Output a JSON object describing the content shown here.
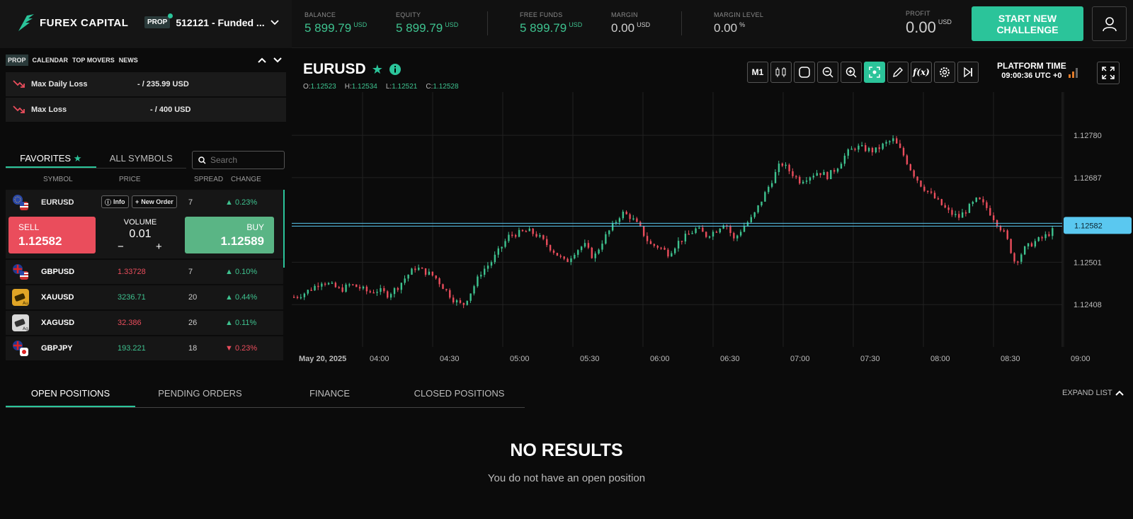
{
  "brand": {
    "name": "FUREX CAPITAL"
  },
  "account": {
    "badge": "PROP",
    "name": "512121 - Funded ..."
  },
  "stats": {
    "balance": {
      "label": "BALANCE",
      "value": "5 899.79",
      "unit": "USD"
    },
    "equity": {
      "label": "EQUITY",
      "value": "5 899.79",
      "unit": "USD"
    },
    "free_funds": {
      "label": "FREE FUNDS",
      "value": "5 899.79",
      "unit": "USD"
    },
    "margin": {
      "label": "MARGIN",
      "value": "0.00",
      "unit": "USD"
    },
    "margin_level": {
      "label": "MARGIN LEVEL",
      "value": "0.00",
      "unit": "%"
    },
    "profit": {
      "label": "PROFIT",
      "value": "0.00",
      "unit": "USD"
    }
  },
  "challenge_button": "START NEW CHALLENGE",
  "subnav": [
    "PROP",
    "CALENDAR",
    "TOP MOVERS",
    "NEWS"
  ],
  "risk": [
    {
      "label": "Max Daily Loss",
      "value": "- / 235.99 USD"
    },
    {
      "label": "Max Loss",
      "value": "- / 400 USD"
    }
  ],
  "symbol_tabs": {
    "favorites": "FAVORITES",
    "all": "ALL SYMBOLS"
  },
  "search": {
    "placeholder": "Search"
  },
  "columns": {
    "symbol": "SYMBOL",
    "price": "PRICE",
    "spread": "SPREAD",
    "change": "CHANGE"
  },
  "eurusd": {
    "name": "EURUSD",
    "spread": "7",
    "change": "0.23%",
    "info_label": "Info",
    "order_label": "New Order",
    "sell_label": "SELL",
    "sell_price": "1.12582",
    "buy_label": "BUY",
    "buy_price": "1.12589",
    "volume_label": "VOLUME",
    "volume": "0.01"
  },
  "symbols": [
    {
      "name": "GBPUSD",
      "price": "1.33728",
      "price_dir": "down",
      "spread": "7",
      "change": "0.10%",
      "change_dir": "up"
    },
    {
      "name": "XAUUSD",
      "price": "3236.71",
      "price_dir": "up",
      "spread": "20",
      "change": "0.44%",
      "change_dir": "up"
    },
    {
      "name": "XAGUSD",
      "price": "32.386",
      "price_dir": "down",
      "spread": "26",
      "change": "0.11%",
      "change_dir": "up"
    },
    {
      "name": "GBPJPY",
      "price": "193.221",
      "price_dir": "up",
      "spread": "18",
      "change": "0.23%",
      "change_dir": "down"
    }
  ],
  "chart": {
    "symbol": "EURUSD",
    "ohlc": {
      "o": "1.12523",
      "h": "1.12534",
      "l": "1.12521",
      "c": "1.12528"
    },
    "timeframe": "M1",
    "platform_time_label": "PLATFORM TIME",
    "platform_time": "09:00:36 UTC +0"
  },
  "chart_data": {
    "type": "candlestick",
    "x_labels": [
      "May 20, 2025",
      "04:00",
      "04:30",
      "05:00",
      "05:30",
      "06:00",
      "06:30",
      "07:00",
      "07:30",
      "08:00",
      "08:30",
      "09:00"
    ],
    "y_ticks": [
      "1.12780",
      "1.12687",
      "1.12501",
      "1.12408"
    ],
    "ylim": [
      1.12315,
      1.12875
    ],
    "current_price": "1.12582",
    "price_path": [
      1.12425,
      1.12432,
      1.12445,
      1.1246,
      1.1245,
      1.1244,
      1.12452,
      1.12445,
      1.12435,
      1.1244,
      1.1243,
      1.12445,
      1.1247,
      1.1249,
      1.1248,
      1.1247,
      1.12445,
      1.1242,
      1.12405,
      1.1244,
      1.1248,
      1.125,
      1.1253,
      1.1256,
      1.12565,
      1.1257,
      1.1256,
      1.1254,
      1.1252,
      1.125,
      1.12525,
      1.1254,
      1.1251,
      1.1255,
      1.1258,
      1.1261,
      1.126,
      1.12575,
      1.1254,
      1.12535,
      1.1252,
      1.12545,
      1.1256,
      1.12575,
      1.1256,
      1.1257,
      1.1259,
      1.1255,
      1.1258,
      1.126,
      1.1264,
      1.1268,
      1.1272,
      1.127,
      1.1268,
      1.1269,
      1.127,
      1.1269,
      1.1271,
      1.1274,
      1.12755,
      1.1275,
      1.12745,
      1.1276,
      1.1277,
      1.1274,
      1.127,
      1.1267,
      1.1265,
      1.1263,
      1.1261,
      1.126,
      1.1262,
      1.1264,
      1.1262,
      1.1259,
      1.1256,
      1.125,
      1.1253,
      1.12545,
      1.12555,
      1.1257
    ]
  },
  "bottom_tabs": [
    "OPEN POSITIONS",
    "PENDING ORDERS",
    "FINANCE",
    "CLOSED POSITIONS"
  ],
  "expand_label": "EXPAND LIST",
  "empty": {
    "title": "NO RESULTS",
    "subtitle": "You do not have an open position"
  },
  "colors": {
    "accent": "#2bc49a",
    "buy": "#5ab585",
    "sell": "#ea4d5c",
    "up": "#3ec28f",
    "down": "#ea4d5c",
    "price_line": "#5ac8f0"
  }
}
